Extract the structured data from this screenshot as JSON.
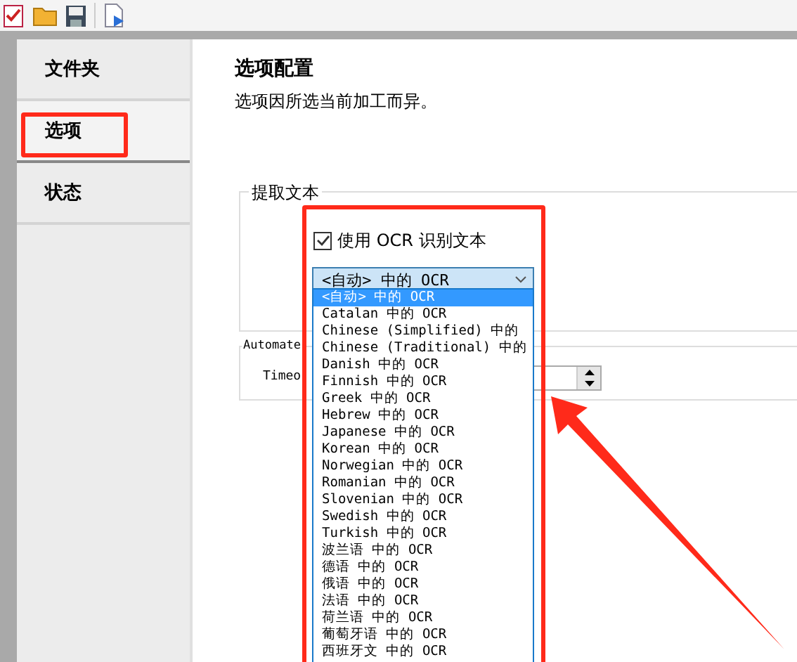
{
  "sidebar": {
    "items": [
      {
        "label": "文件夹",
        "selected": false
      },
      {
        "label": "选项",
        "selected": true
      },
      {
        "label": "状态",
        "selected": false
      }
    ]
  },
  "page": {
    "title": "选项配置",
    "subtitle": "选项因所选当前加工而异。"
  },
  "extract_group": {
    "legend": "提取文本",
    "checkbox": {
      "label": "使用 OCR 识别文本",
      "checked": true
    },
    "combo": {
      "value": "<自动> 中的 OCR"
    }
  },
  "automate_group": {
    "legend": "Automate",
    "timeout_label": "Timeo"
  },
  "dropdown": {
    "items": [
      {
        "label": "<自动> 中的 OCR",
        "selected": true
      },
      {
        "label": "Catalan 中的 OCR",
        "selected": false
      },
      {
        "label": "Chinese (Simplified) 中的",
        "selected": false
      },
      {
        "label": "Chinese (Traditional) 中的",
        "selected": false
      },
      {
        "label": "Danish 中的 OCR",
        "selected": false
      },
      {
        "label": "Finnish 中的 OCR",
        "selected": false
      },
      {
        "label": "Greek 中的 OCR",
        "selected": false
      },
      {
        "label": "Hebrew 中的 OCR",
        "selected": false
      },
      {
        "label": "Japanese 中的 OCR",
        "selected": false
      },
      {
        "label": "Korean 中的 OCR",
        "selected": false
      },
      {
        "label": "Norwegian 中的 OCR",
        "selected": false
      },
      {
        "label": "Romanian 中的 OCR",
        "selected": false
      },
      {
        "label": "Slovenian 中的 OCR",
        "selected": false
      },
      {
        "label": "Swedish 中的 OCR",
        "selected": false
      },
      {
        "label": "Turkish 中的 OCR",
        "selected": false
      },
      {
        "label": "波兰语 中的 OCR",
        "selected": false
      },
      {
        "label": "德语 中的 OCR",
        "selected": false
      },
      {
        "label": "俄语 中的 OCR",
        "selected": false
      },
      {
        "label": "法语 中的 OCR",
        "selected": false
      },
      {
        "label": "荷兰语 中的 OCR",
        "selected": false
      },
      {
        "label": "葡萄牙语 中的 OCR",
        "selected": false
      },
      {
        "label": "西班牙文 中的 OCR",
        "selected": false
      }
    ]
  }
}
